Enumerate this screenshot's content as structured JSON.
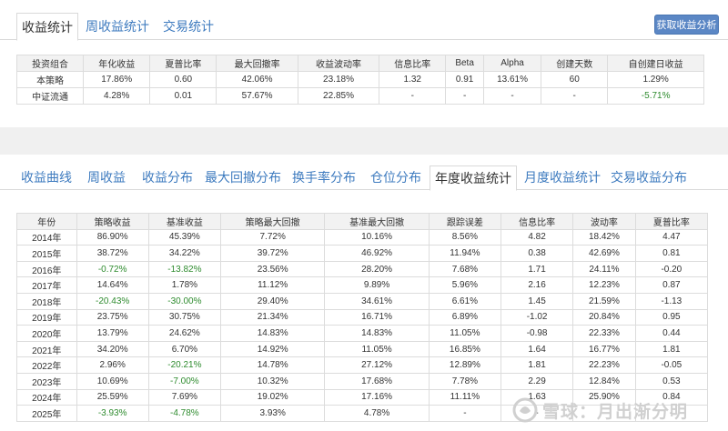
{
  "top_tabs": [
    "收益统计",
    "周收益统计",
    "交易统计"
  ],
  "analyze_button": "获取收益分析",
  "summary": {
    "headers": [
      "投资组合",
      "年化收益",
      "夏普比率",
      "最大回撤率",
      "收益波动率",
      "信息比率",
      "Beta",
      "Alpha",
      "创建天数",
      "自创建日收益"
    ],
    "rows": [
      [
        "本策略",
        "17.86%",
        "0.60",
        "42.06%",
        "23.18%",
        "1.32",
        "0.91",
        "13.61%",
        "60",
        "1.29%"
      ],
      [
        "中证流通",
        "4.28%",
        "0.01",
        "57.67%",
        "22.85%",
        "-",
        "-",
        "-",
        "-",
        "-5.71%"
      ]
    ]
  },
  "bottom_tabs": [
    "收益曲线",
    "周收益",
    "收益分布",
    "最大回撤分布",
    "换手率分布",
    "仓位分布",
    "年度收益统计",
    "月度收益统计",
    "交易收益分布"
  ],
  "yearly": {
    "headers": [
      "年份",
      "策略收益",
      "基准收益",
      "策略最大回撤",
      "基准最大回撤",
      "跟踪误差",
      "信息比率",
      "波动率",
      "夏普比率"
    ],
    "rows": [
      [
        "2014年",
        "86.90%",
        "45.39%",
        "7.72%",
        "10.16%",
        "8.56%",
        "4.82",
        "18.42%",
        "4.47"
      ],
      [
        "2015年",
        "38.72%",
        "34.22%",
        "39.72%",
        "46.92%",
        "11.94%",
        "0.38",
        "42.69%",
        "0.81"
      ],
      [
        "2016年",
        "-0.72%",
        "-13.82%",
        "23.56%",
        "28.20%",
        "7.68%",
        "1.71",
        "24.11%",
        "-0.20"
      ],
      [
        "2017年",
        "14.64%",
        "1.78%",
        "11.12%",
        "9.89%",
        "5.96%",
        "2.16",
        "12.23%",
        "0.87"
      ],
      [
        "2018年",
        "-20.43%",
        "-30.00%",
        "29.40%",
        "34.61%",
        "6.61%",
        "1.45",
        "21.59%",
        "-1.13"
      ],
      [
        "2019年",
        "23.75%",
        "30.75%",
        "21.34%",
        "16.71%",
        "6.89%",
        "-1.02",
        "20.84%",
        "0.95"
      ],
      [
        "2020年",
        "13.79%",
        "24.62%",
        "14.83%",
        "14.83%",
        "11.05%",
        "-0.98",
        "22.33%",
        "0.44"
      ],
      [
        "2021年",
        "34.20%",
        "6.70%",
        "14.92%",
        "11.05%",
        "16.85%",
        "1.64",
        "16.77%",
        "1.81"
      ],
      [
        "2022年",
        "2.96%",
        "-20.21%",
        "14.78%",
        "27.12%",
        "12.89%",
        "1.81",
        "22.23%",
        "-0.05"
      ],
      [
        "2023年",
        "10.69%",
        "-7.00%",
        "10.32%",
        "17.68%",
        "7.78%",
        "2.29",
        "12.84%",
        "0.53"
      ],
      [
        "2024年",
        "25.59%",
        "7.69%",
        "19.02%",
        "17.16%",
        "11.11%",
        "1.63",
        "25.90%",
        "0.84"
      ],
      [
        "2025年",
        "-3.93%",
        "-4.78%",
        "3.93%",
        "4.78%",
        "-",
        "-",
        "-",
        "-"
      ]
    ]
  },
  "watermark": "雪球：月出渐分明",
  "colors": {
    "accent": "#3e7bbf",
    "button": "#5b87c5",
    "negative": "#2e8b2e",
    "header_bg": "#f2f2f2"
  }
}
